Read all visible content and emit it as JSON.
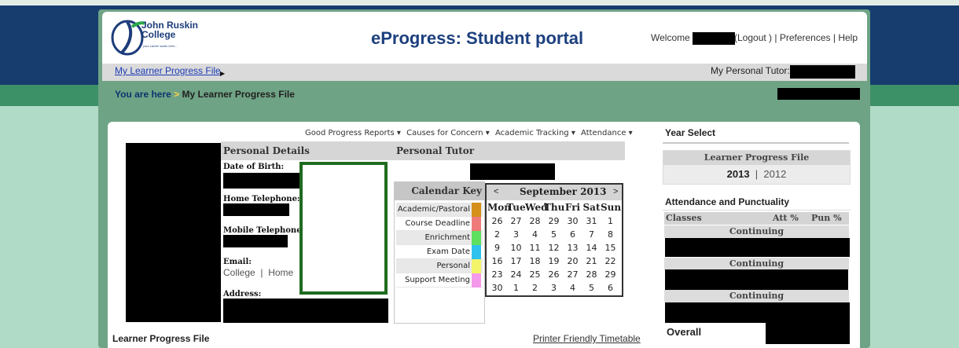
{
  "header": {
    "logo_line1": "John Ruskin",
    "logo_line2": "College",
    "logo_tagline": "your career starts here...",
    "title": "eProgress: Student portal",
    "welcome_label": "Welcome",
    "logout_label": "(Logout )",
    "preferences_label": "Preferences",
    "help_label": "Help"
  },
  "nav": {
    "learner_progress_link": "My Learner Progress File",
    "arrow_glyph": "▶",
    "tutor_label": "My Personal Tutor:"
  },
  "breadcrumb": {
    "prefix": "You are here",
    "separator": ">",
    "current": "My Learner Progress File"
  },
  "menu": {
    "items": [
      "Good Progress Reports ▾",
      "Causes for Concern ▾",
      "Academic Tracking ▾",
      "Attendance ▾"
    ]
  },
  "personal_details": {
    "heading": "Personal Details",
    "dob_label": "Date of Birth:",
    "home_tel_label": "Home Telephone:",
    "mobile_tel_label": "Mobile Telephone",
    "email_label": "Email:",
    "email_college": "College",
    "email_sep": "|",
    "email_home": "Home",
    "address_label": "Address:"
  },
  "personal_tutor": {
    "heading": "Personal Tutor"
  },
  "calendar_key": {
    "heading": "Calendar Key",
    "items": [
      {
        "label": "Academic/Pastoral",
        "color": "#d4901a"
      },
      {
        "label": "Course Deadline",
        "color": "#ef7a7a"
      },
      {
        "label": "Enrichment",
        "color": "#5ee05e"
      },
      {
        "label": "Exam Date",
        "color": "#2fc2ef"
      },
      {
        "label": "Personal",
        "color": "#f4f46a"
      },
      {
        "label": "Support Meeting",
        "color": "#f59aea"
      }
    ]
  },
  "calendar": {
    "prev": "<",
    "next": ">",
    "month_label": "September 2013",
    "days_of_week": [
      "Mon",
      "Tue",
      "Wed",
      "Thu",
      "Fri",
      "Sat",
      "Sun"
    ],
    "weeks": [
      [
        "26",
        "27",
        "28",
        "29",
        "30",
        "31",
        "1"
      ],
      [
        "2",
        "3",
        "4",
        "5",
        "6",
        "7",
        "8"
      ],
      [
        "9",
        "10",
        "11",
        "12",
        "13",
        "14",
        "15"
      ],
      [
        "16",
        "17",
        "18",
        "19",
        "20",
        "21",
        "22"
      ],
      [
        "23",
        "24",
        "25",
        "26",
        "27",
        "28",
        "29"
      ],
      [
        "30",
        "1",
        "2",
        "3",
        "4",
        "5",
        "6"
      ]
    ]
  },
  "year_select": {
    "title": "Year Select",
    "box_heading": "Learner Progress File",
    "current_year": "2013",
    "sep": "|",
    "other_year": "2012"
  },
  "attendance": {
    "title": "Attendance and Punctuality",
    "col_classes": "Classes",
    "col_att": "Att %",
    "col_pun": "Pun %",
    "groups": [
      "Continuing",
      "Continuing",
      "Continuing"
    ],
    "overall_label": "Overall"
  },
  "footer": {
    "left": "Learner Progress File",
    "right": "Printer Friendly Timetable"
  }
}
